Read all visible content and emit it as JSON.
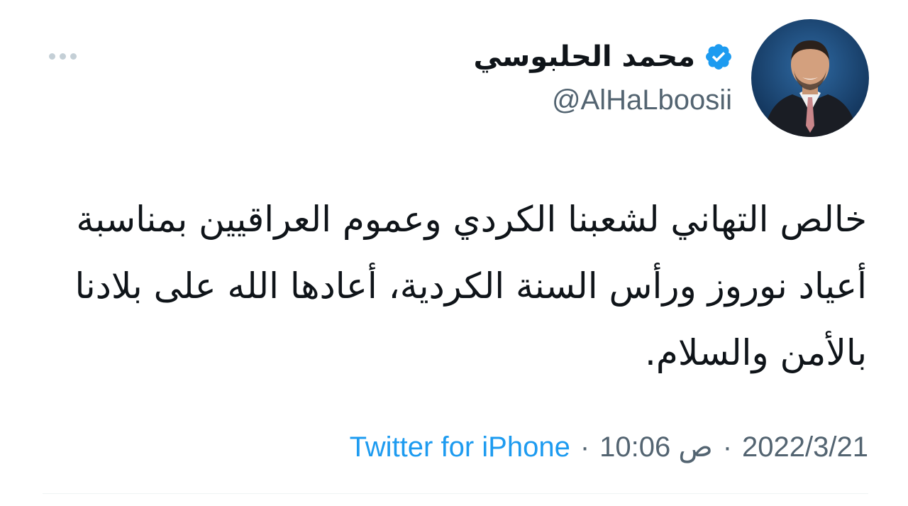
{
  "tweet": {
    "author": {
      "display_name": "محمد الحلبوسي",
      "handle": "@AlHaLboosii",
      "verified": true,
      "verified_icon": "verified-badge-icon",
      "avatar_icon": "profile-photo",
      "badge_color": "#1d9bf0"
    },
    "more_icon": "more-options-icon",
    "text": "خالص التهاني لشعبنا الكردي وعموم العراقيين بمناسبة أعياد نوروز ورأس السنة الكردية، أعادها الله على بلادنا بالأمن والسلام.",
    "meta": {
      "date": "2022/3/21",
      "separator": "·",
      "time": "10:06 ص",
      "source": "Twitter for iPhone"
    },
    "colors": {
      "text": "#0f1419",
      "secondary": "#536471",
      "link": "#1d9bf0"
    }
  }
}
